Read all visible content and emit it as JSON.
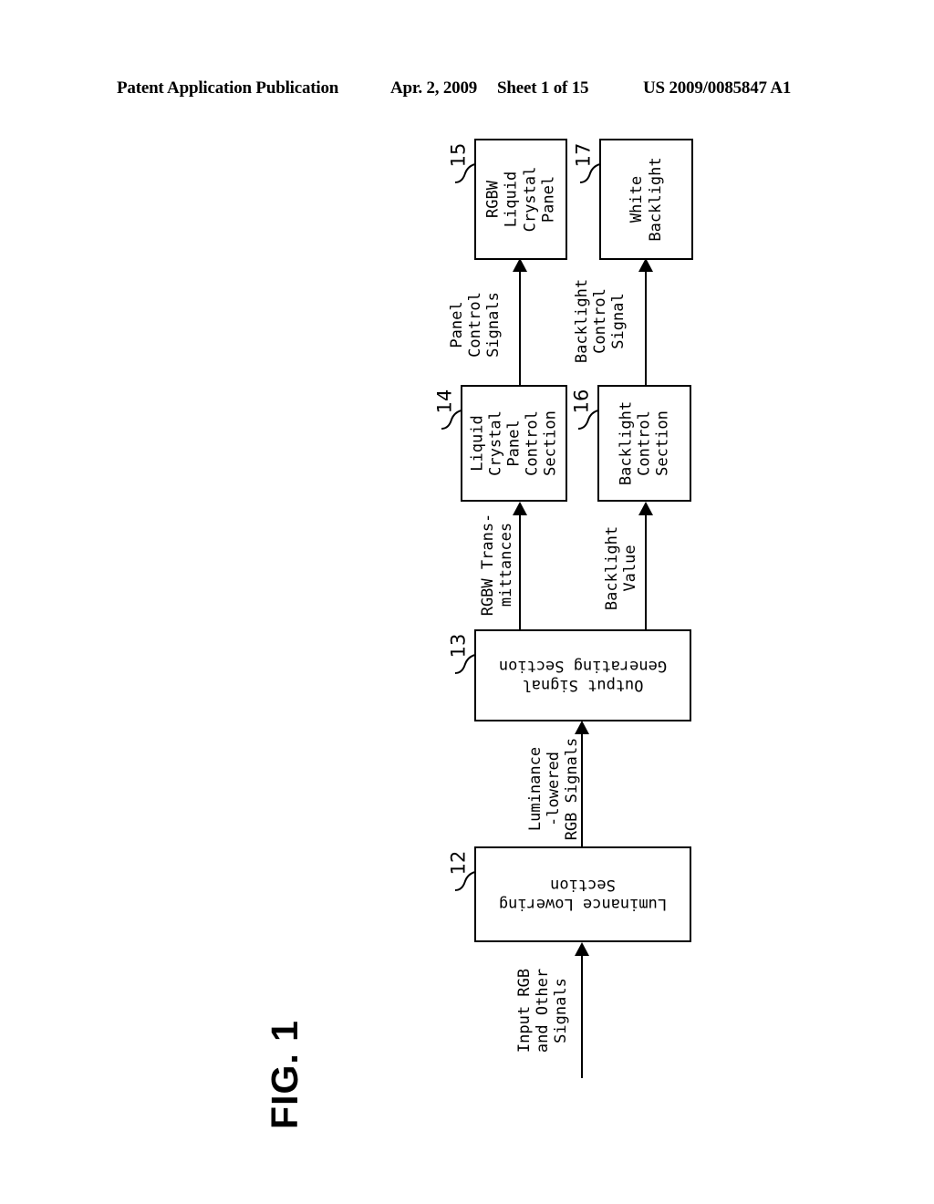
{
  "header": {
    "publication": "Patent Application Publication",
    "date": "Apr. 2, 2009",
    "sheet": "Sheet 1 of 15",
    "patent_number": "US 2009/0085847 A1"
  },
  "figure": {
    "label": "FIG. 1"
  },
  "diagram": {
    "type": "block-diagram",
    "nodes": [
      {
        "ref": "15",
        "label": "RGBW Liquid\nCrystal\nPanel",
        "rotation": "ccw"
      },
      {
        "ref": "17",
        "label": "White\nBacklight",
        "rotation": "ccw"
      },
      {
        "ref": "14",
        "label": "Liquid\nCrystal\nPanel\nControl\nSection",
        "rotation": "ccw"
      },
      {
        "ref": "16",
        "label": "Backlight\nControl\nSection",
        "rotation": "ccw"
      },
      {
        "ref": "13",
        "label": "Output Signal\nGenerating Section",
        "rotation": "180"
      },
      {
        "ref": "12",
        "label": "Luminance Lowering\nSection",
        "rotation": "180"
      }
    ],
    "edges": [
      {
        "label": "Panel\nControl\nSignals",
        "from": "14",
        "to": "15"
      },
      {
        "label": "Backlight\nControl\nSignal",
        "from": "16",
        "to": "17"
      },
      {
        "label": "RGBW Trans-\nmittances",
        "from": "13",
        "to": "14"
      },
      {
        "label": "Backlight\nValue",
        "from": "13",
        "to": "16"
      },
      {
        "label": "Luminance\n-lowered\nRGB Signals",
        "from": "12",
        "to": "13"
      },
      {
        "label": "Input RGB\nand Other\nSignals",
        "from": "",
        "to": "12"
      }
    ]
  }
}
